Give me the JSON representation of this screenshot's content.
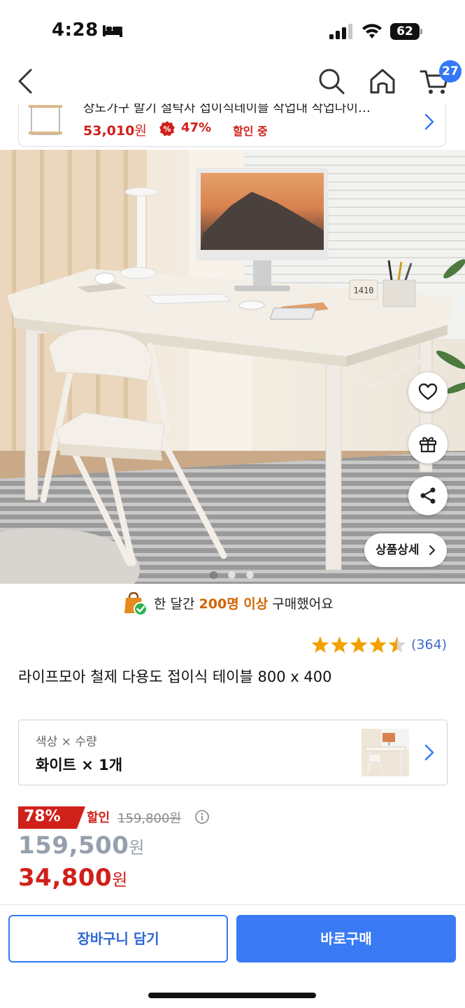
{
  "status_bar": {
    "time": "4:28",
    "battery": "62",
    "icons": [
      "bed-icon",
      "signal-icon",
      "wifi-icon",
      "battery-icon"
    ]
  },
  "nav": {
    "icons": [
      "back-chevron-icon",
      "search-icon",
      "home-icon",
      "cart-icon"
    ],
    "cart_count": "27"
  },
  "compare_card": {
    "title": "장노가구 발기 철탁자 접이식테이블 작업대 작업나이…",
    "price": "53,010",
    "won": "원",
    "discount": "47%",
    "discount_text": "할인 중"
  },
  "image_actions": {
    "icons": [
      "heart-icon",
      "gift-icon",
      "share-icon"
    ],
    "detail_button": "상품상세",
    "page_dots": 3,
    "active_dot": 0
  },
  "social_proof": {
    "prefix": "한 달간 ",
    "highlight": "200명 이상",
    "suffix": " 구매했어요"
  },
  "rating": {
    "stars": 4.5,
    "max_stars": 5,
    "review_count": "(364)"
  },
  "product": {
    "title": "라이프모아 철제 다용도 접이식 테이블 800 x 400"
  },
  "option": {
    "label": "색상 × 수량",
    "value": "화이트 × 1개"
  },
  "price": {
    "discount_percent": "78%",
    "discount_label": "할인",
    "original": "159,800원",
    "list_price": "159,500",
    "sale_price": "34,800",
    "won": "원"
  },
  "bottom_bar": {
    "cart_button": "장바구니 담기",
    "buy_button": "바로구매"
  },
  "colors": {
    "accent_blue": "#3478f6",
    "sale_red": "#d0201a",
    "highlight_orange": "#d36300",
    "star_gold": "#f2a100"
  }
}
